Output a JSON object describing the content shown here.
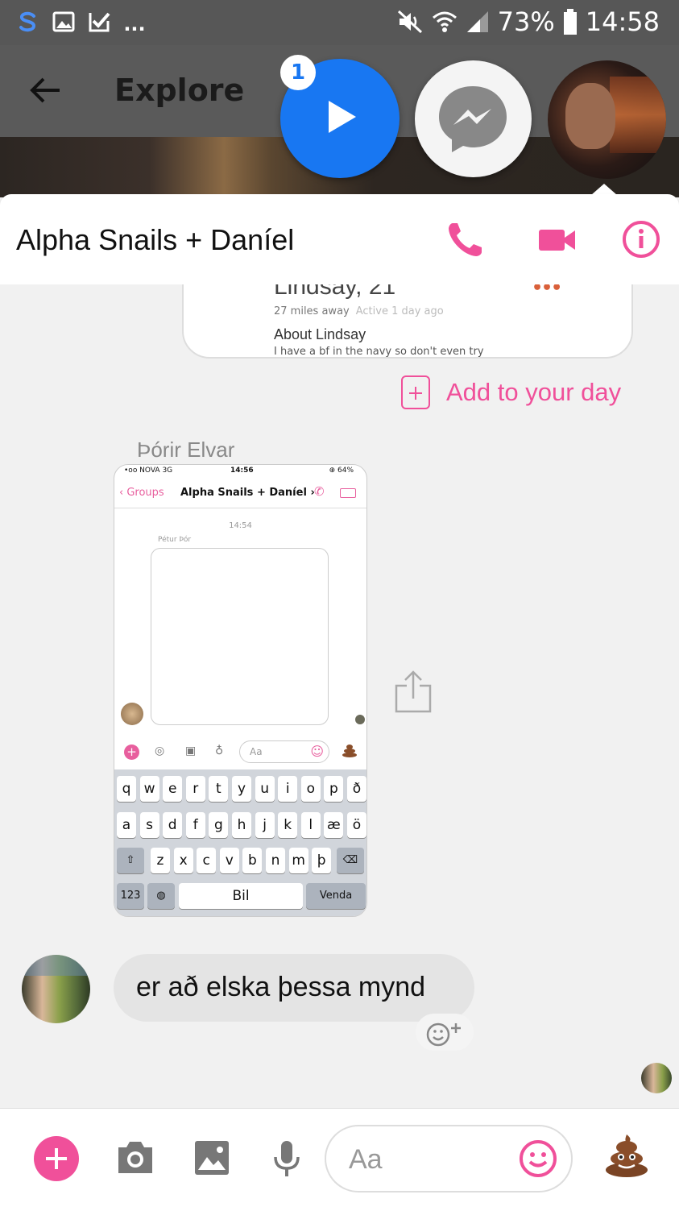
{
  "status_bar": {
    "battery": "73%",
    "time": "14:58",
    "overflow": "...",
    "left_icons": [
      "s-app-icon",
      "gallery-icon",
      "checklist-icon"
    ],
    "right_icons": [
      "mute-icon",
      "wifi-icon",
      "signal-icon",
      "battery-icon"
    ]
  },
  "explore_header": {
    "title": "Explore"
  },
  "chat_heads": {
    "badge_count": "1"
  },
  "conversation": {
    "title": "Alpha Snails + Daníel",
    "accent_color": "#f0509a"
  },
  "tinder_card": {
    "name": "Lindsay, 21",
    "distance": "27 miles away",
    "active": "Active 1 day ago",
    "about_title": "About Lindsay",
    "bio": "I have a bf in the navy so don't even try",
    "dots": "•••"
  },
  "add_to_day": "Add to your day",
  "sender_name": "Þórir Elvar",
  "embedded_screenshot": {
    "carrier": "•oo NOVA  3G",
    "time": "14:56",
    "battery": "⊕ 64%",
    "back_label": "Groups",
    "title": "Alpha Snails + Daníel",
    "timestamp": "14:54",
    "sender": "Pétur Þór",
    "input_placeholder": "Aa",
    "keyboard_row1": [
      "q",
      "w",
      "e",
      "r",
      "t",
      "y",
      "u",
      "i",
      "o",
      "p",
      "ð"
    ],
    "keyboard_row2": [
      "a",
      "s",
      "d",
      "f",
      "g",
      "h",
      "j",
      "k",
      "l",
      "æ",
      "ö"
    ],
    "keyboard_row3": [
      "z",
      "x",
      "c",
      "v",
      "b",
      "n",
      "m",
      "þ"
    ],
    "key_numbers": "123",
    "key_space": "Bil",
    "key_send": "Venda"
  },
  "message": {
    "text": "er að elska þessa mynd"
  },
  "composer": {
    "placeholder": "Aa"
  }
}
